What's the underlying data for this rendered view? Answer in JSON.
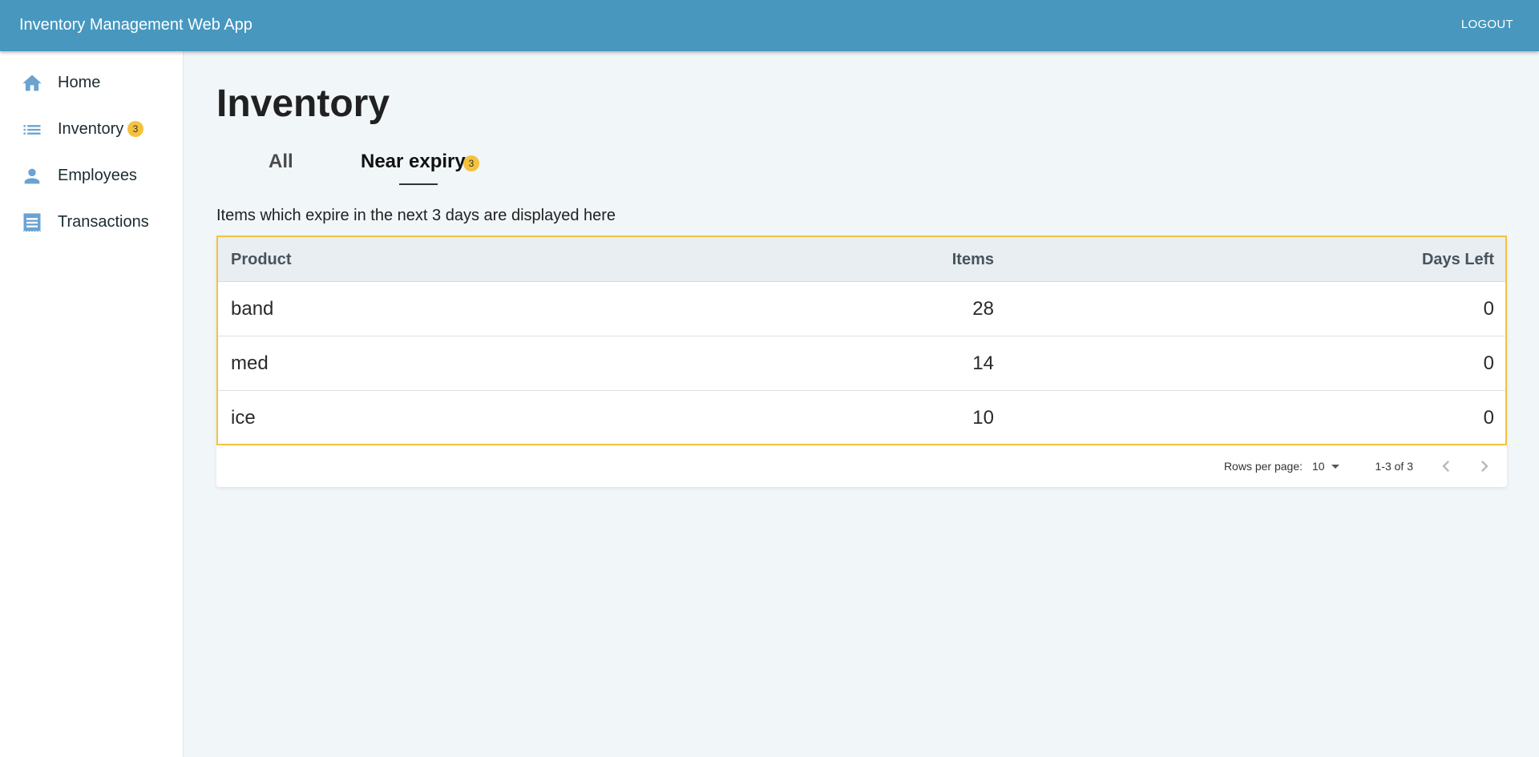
{
  "app": {
    "title": "Inventory Management Web App",
    "logout_label": "LOGOUT"
  },
  "sidebar": {
    "items": [
      {
        "label": "Home",
        "icon": "home-icon"
      },
      {
        "label": "Inventory",
        "icon": "list-icon",
        "badge": "3"
      },
      {
        "label": "Employees",
        "icon": "person-icon"
      },
      {
        "label": "Transactions",
        "icon": "receipt-icon"
      }
    ]
  },
  "main": {
    "title": "Inventory",
    "tabs": [
      {
        "label": "All"
      },
      {
        "label": "Near expiry",
        "badge": "3",
        "active": true
      }
    ],
    "description": "Items which expire in the next 3 days are displayed here"
  },
  "table": {
    "columns": [
      "Product",
      "Items",
      "Days Left"
    ],
    "rows": [
      [
        "band",
        "28",
        "0"
      ],
      [
        "med",
        "14",
        "0"
      ],
      [
        "ice",
        "10",
        "0"
      ]
    ]
  },
  "pagination": {
    "rows_per_page_label": "Rows per page:",
    "rows_per_page_value": "10",
    "range_label": "1-3 of 3"
  },
  "colors": {
    "appbar": "#4797bf",
    "badge": "#f5c23e",
    "nav_icon": "#5a9bd0",
    "table_highlight_border": "#f5c23e"
  }
}
